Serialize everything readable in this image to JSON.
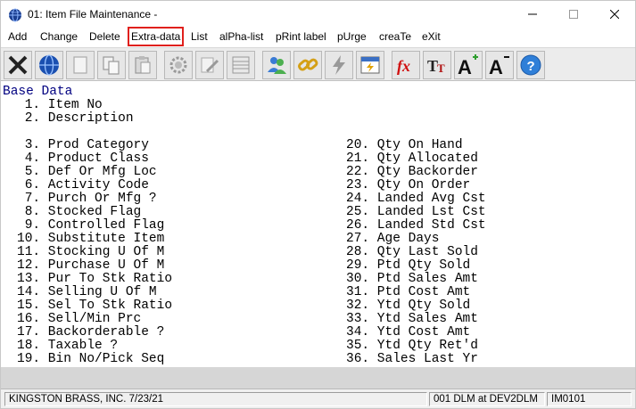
{
  "window": {
    "title": "01: Item File Maintenance -"
  },
  "menu": [
    {
      "label": "Add"
    },
    {
      "label": "Change"
    },
    {
      "label": "Delete"
    },
    {
      "label": "Extra-data"
    },
    {
      "label": "List"
    },
    {
      "label": "alPha-list"
    },
    {
      "label": "pRint label"
    },
    {
      "label": "pUrge"
    },
    {
      "label": "creaTe"
    },
    {
      "label": "eXit"
    }
  ],
  "toolbar": [
    {
      "icon": "close-x-icon"
    },
    {
      "icon": "globe-icon"
    },
    {
      "icon": "blank-page-icon"
    },
    {
      "icon": "copy-icon"
    },
    {
      "icon": "paste-icon"
    },
    {
      "icon": "gear-icon"
    },
    {
      "icon": "edit-icon"
    },
    {
      "icon": "list-icon"
    },
    {
      "icon": "users-icon"
    },
    {
      "icon": "link-icon"
    },
    {
      "icon": "lightning-icon"
    },
    {
      "icon": "calendar-icon"
    },
    {
      "icon": "function-icon"
    },
    {
      "icon": "font-size-icon"
    },
    {
      "icon": "font-increase-icon"
    },
    {
      "icon": "font-decrease-icon"
    },
    {
      "icon": "help-icon"
    }
  ],
  "content": {
    "section_title": "Base Data",
    "left_fields": [
      " 1. Item No",
      " 2. Description",
      "",
      " 3. Prod Category",
      " 4. Product Class",
      " 5. Def Or Mfg Loc",
      " 6. Activity Code",
      " 7. Purch Or Mfg ?",
      " 8. Stocked Flag",
      " 9. Controlled Flag",
      "10. Substitute Item",
      "11. Stocking U Of M",
      "12. Purchase U Of M",
      "13. Pur To Stk Ratio",
      "14. Selling U Of M",
      "15. Sel To Stk Ratio",
      "16. Sell/Min Prc",
      "17. Backorderable ?",
      "18. Taxable ?",
      "19. Bin No/Pick Seq"
    ],
    "right_fields": [
      "20. Qty On Hand",
      "21. Qty Allocated",
      "22. Qty Backorder",
      "23. Qty On Order",
      "24. Landed Avg Cst",
      "25. Landed Lst Cst",
      "26. Landed Std Cst",
      "27. Age Days",
      "28. Qty Last Sold",
      "29. Ptd Qty Sold",
      "30. Ptd Sales Amt",
      "31. Ptd Cost Amt",
      "32. Ytd Qty Sold",
      "33. Ytd Sales Amt",
      "34. Ytd Cost Amt",
      "35. Ytd Qty Ret'd",
      "36. Sales Last Yr"
    ]
  },
  "status": {
    "company": "KINGSTON BRASS, INC. 7/23/21",
    "user": "001 DLM at DEV2DLM",
    "program": "IM0101"
  },
  "colors": {
    "section_title": "#000080",
    "highlight_outline": "#e0201c",
    "toolbar_bg": "#ececec"
  }
}
